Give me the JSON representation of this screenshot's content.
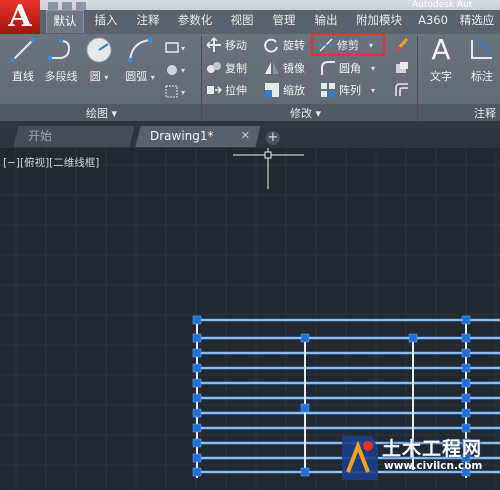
{
  "app_logo": "A",
  "title_fragment": "Autodesk Aut",
  "ribbon_tabs": [
    "默认",
    "插入",
    "注释",
    "参数化",
    "视图",
    "管理",
    "输出",
    "附加模块",
    "A360",
    "精选应"
  ],
  "draw": {
    "line": "直线",
    "polyline": "多段线",
    "circle": "圆",
    "arc": "圆弧",
    "panel_title": "绘图 ▾"
  },
  "modify": {
    "move": "移动",
    "rotate": "旋转",
    "trim": "修剪",
    "copy": "复制",
    "mirror": "镜像",
    "fillet": "圆角",
    "stretch": "拉伸",
    "scale": "缩放",
    "array": "阵列",
    "panel_title": "修改 ▾"
  },
  "annotation": {
    "text": "文字",
    "dimension": "标注",
    "panel_title": "注释"
  },
  "doc_tabs": [
    {
      "label": "开始"
    },
    {
      "label": "Drawing1*"
    }
  ],
  "new_tab": "+",
  "viewport_label": "[−][俯视][二维线框]",
  "watermark": {
    "cn": "土木工程网",
    "url": "www.civilcn.com"
  },
  "colors": {
    "highlight": "#e8322a",
    "accent": "#2d7fd6",
    "arrow": "#e8322a"
  }
}
